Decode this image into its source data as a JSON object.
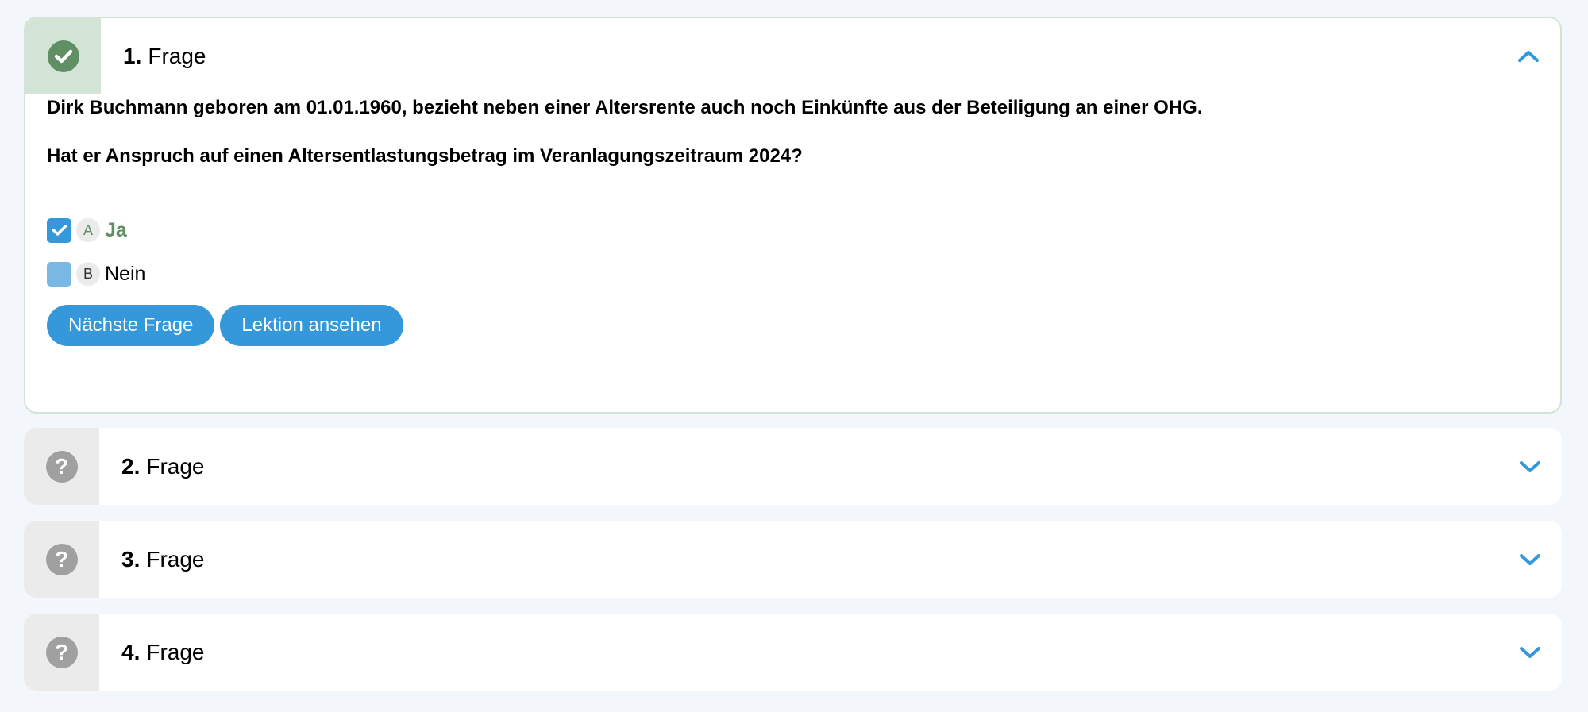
{
  "questions": [
    {
      "number": "1.",
      "label": "Frage",
      "status": "done",
      "expanded": true,
      "text": [
        "Dirk Buchmann geboren am 01.01.1960, bezieht neben einer Altersrente auch noch Einkünfte aus der Beteiligung an einer OHG.",
        "Hat er Anspruch auf einen Altersentlastungsbetrag im Veranlagungszeitraum 2024?"
      ],
      "answers": [
        {
          "letter": "A",
          "text": "Ja",
          "checked": true,
          "correct": true
        },
        {
          "letter": "B",
          "text": "Nein",
          "checked": false,
          "correct": false
        }
      ],
      "buttons": {
        "next": "Nächste Frage",
        "lesson": "Lektion ansehen"
      }
    },
    {
      "number": "2.",
      "label": "Frage",
      "status": "pending",
      "expanded": false
    },
    {
      "number": "3.",
      "label": "Frage",
      "status": "pending",
      "expanded": false
    },
    {
      "number": "4.",
      "label": "Frage",
      "status": "pending",
      "expanded": false
    }
  ],
  "icons": {
    "done": "check-circle-icon",
    "pending": "question-circle-icon",
    "expanded": "chevron-up-icon",
    "collapsed": "chevron-down-icon"
  },
  "colors": {
    "page_background": "#f3f7fc",
    "correct_green": "#5f8f63",
    "done_cell": "#d3e4d6",
    "pending_cell": "#ebebeb",
    "accent_blue": "#3498db",
    "unchecked_blue": "#7ab8e4"
  },
  "pending_glyph": "?"
}
